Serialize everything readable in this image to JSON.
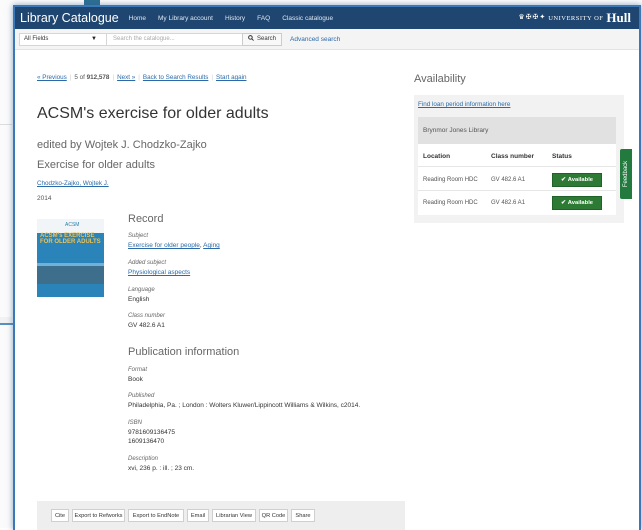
{
  "header": {
    "brand": "Library Catalogue",
    "nav": [
      "Home",
      "My Library account",
      "History",
      "FAQ",
      "Classic catalogue"
    ],
    "university_small": "UNIVERSITY OF",
    "university_big": "Hull"
  },
  "search": {
    "field_value": "All Fields",
    "placeholder": "Search the catalogue...",
    "button_label": "Search",
    "advanced_label": "Advanced search"
  },
  "pager": {
    "previous": "« Previous",
    "position_prefix": "5 of",
    "total": "912,578",
    "next": "Next »",
    "back": "Back to Search Results",
    "start_again": "Start again"
  },
  "record": {
    "title": "ACSM's exercise for older adults",
    "editor": "edited by Wojtek J. Chodzko-Zajko",
    "series_title": "Exercise for older adults",
    "author_link": "Chodzko-Zajko, Wojtek J.",
    "year": "2014",
    "cover_text": "ACSM's EXERCISE FOR OLDER ADULTS",
    "cover_logo": "ACSM",
    "section_record": "Record",
    "subject_label": "Subject",
    "subject_links": [
      "Exercise for older people",
      "Aging"
    ],
    "added_subject_label": "Added subject",
    "added_subject": "Physiological aspects",
    "language_label": "Language",
    "language": "English",
    "class_label": "Class number",
    "class_number": "GV 482.6 A1",
    "section_pub": "Publication information",
    "format_label": "Format",
    "format": "Book",
    "published_label": "Published",
    "published": "Philadelphia, Pa. ; London : Wolters Kluwer/Lippincott Williams & Wilkins, c2014.",
    "isbn_label": "ISBN",
    "isbn": [
      "9781609136475",
      "1609136470"
    ],
    "description_label": "Description",
    "description": "xvi, 236 p. : ill. ; 23 cm."
  },
  "actions": [
    "Cite",
    "Export to Refworks",
    "Export to EndNote",
    "Email",
    "Librarian View",
    "QR Code",
    "Share"
  ],
  "availability": {
    "heading": "Availability",
    "loan_link": "Find loan period information here",
    "library": "Brynmor Jones Library",
    "columns": [
      "Location",
      "Class number",
      "Status"
    ],
    "rows": [
      {
        "location": "Reading Room HDC",
        "class_number": "GV 482.6 A1",
        "status": "Available"
      },
      {
        "location": "Reading Room HDC",
        "class_number": "GV 482.6 A1",
        "status": "Available"
      }
    ],
    "status_color": "#2c7a33"
  },
  "feedback_label": "Feedback",
  "colors": {
    "topbar": "#1f4670",
    "link": "#2b6aa8",
    "feedback": "#227a3e"
  }
}
